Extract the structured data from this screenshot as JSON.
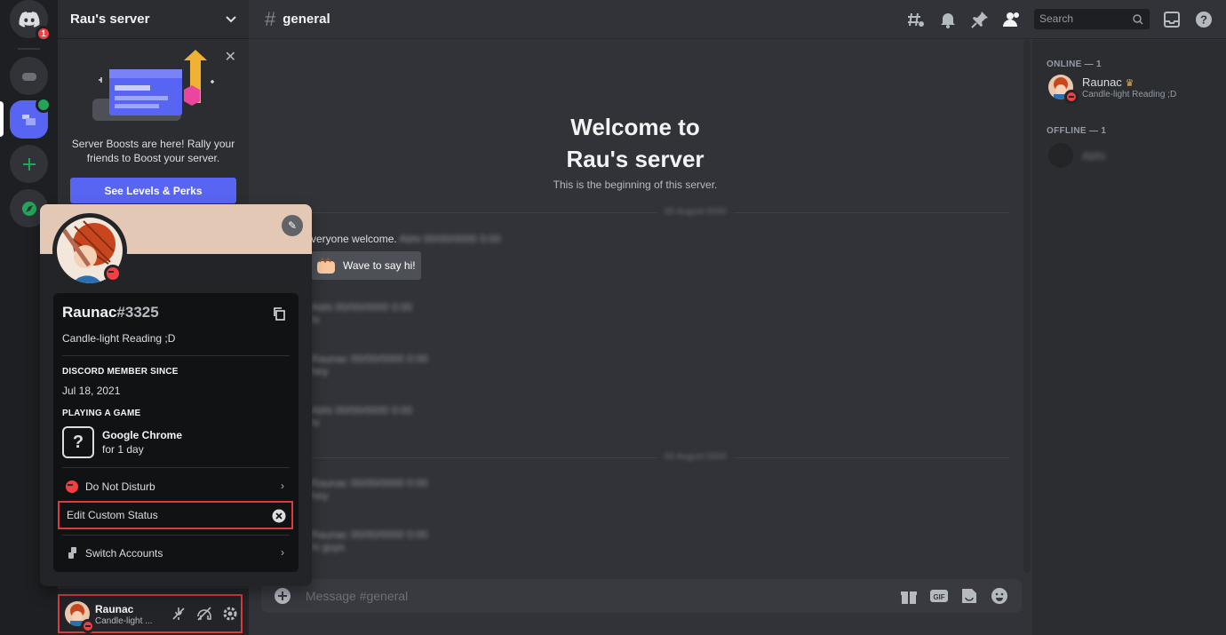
{
  "sidebar": {
    "server_name": "Rau's server",
    "boost_text": "Server Boosts are here! Rally your friends to Boost your server.",
    "boost_button": "See Levels & Perks"
  },
  "rail": {
    "home_badge": "1"
  },
  "header": {
    "channel": "general",
    "search_placeholder": "Search"
  },
  "chat": {
    "welcome_title_1": "Welcome to",
    "welcome_title_2": "Rau's server",
    "welcome_sub": "This is the beginning of this server.",
    "first_message": "veryone welcome.",
    "wave_button": "Wave to say hi!",
    "composer_placeholder": "Message #general"
  },
  "members": {
    "online_header": "ONLINE — 1",
    "offline_header": "OFFLINE — 1",
    "online_user": "Raunac",
    "online_status": "Candle-light Reading ;D"
  },
  "profile": {
    "username": "Raunac",
    "tag": "#3325",
    "custom_status": "Candle-light Reading ;D",
    "member_since_label": "DISCORD MEMBER SINCE",
    "member_since": "Jul 18, 2021",
    "activity_label": "PLAYING A GAME",
    "game_name": "Google Chrome",
    "game_duration": "for 1 day",
    "game_icon_glyph": "?",
    "dnd_label": "Do Not Disturb",
    "edit_status_label": "Edit Custom Status",
    "switch_label": "Switch Accounts"
  },
  "userbar": {
    "name": "Raunac",
    "status": "Candle-light ..."
  },
  "colors": {
    "accent": "#5865f2",
    "dnd": "#f23f43",
    "highlight": "#d83c3e"
  }
}
